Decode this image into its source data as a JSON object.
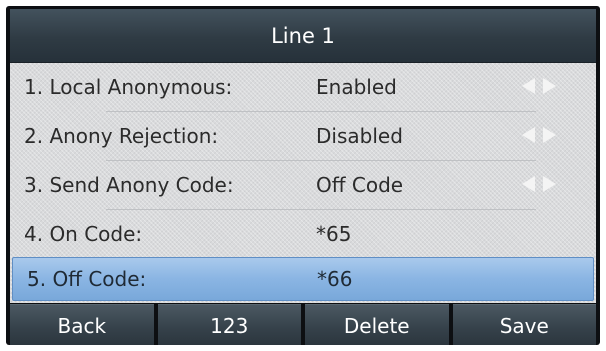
{
  "title": "Line 1",
  "rows": [
    {
      "label": "1. Local Anonymous:",
      "value": "Enabled",
      "has_arrows": true
    },
    {
      "label": "2. Anony Rejection:",
      "value": "Disabled",
      "has_arrows": true
    },
    {
      "label": "3. Send Anony Code:",
      "value": "Off Code",
      "has_arrows": true
    },
    {
      "label": "4. On Code:",
      "value": "*65",
      "has_arrows": false
    },
    {
      "label": "5. Off Code:",
      "value": "*66",
      "has_arrows": false,
      "selected": true
    }
  ],
  "softkeys": {
    "back": "Back",
    "ime": "123",
    "delete": "Delete",
    "save": "Save"
  },
  "colors": {
    "title_bar": "#2f3b44",
    "selected_row": "#8ab5e3",
    "content_bg": "#d9dadc"
  },
  "icons": [
    "arrow-left-icon",
    "arrow-right-icon"
  ]
}
